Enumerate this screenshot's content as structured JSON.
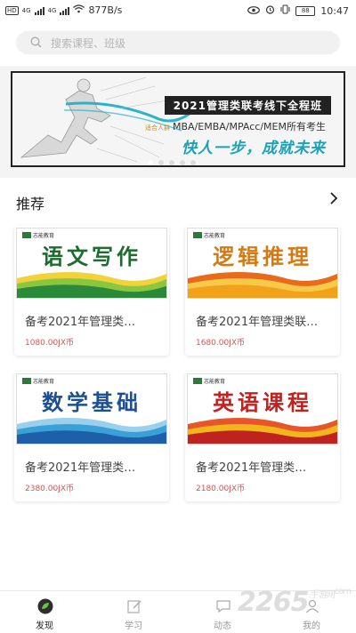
{
  "status_bar": {
    "speed": "877B/s",
    "battery": "88",
    "time": "10:47",
    "hd1": "HD",
    "hd2": "HD",
    "net1": "4G",
    "net2": "4G"
  },
  "search": {
    "placeholder": "搜索课程、班级"
  },
  "banner": {
    "title": "2021管理类联考线下全程班",
    "sub_small": "适合人群",
    "subtitle": "MBA/EMBA/MPAcc/MEM所有考生",
    "slogan": "快人一步，成就未来",
    "dots": 5,
    "active_dot": 0
  },
  "recommend": {
    "heading": "推荐",
    "more_icon": "chevron-right-icon",
    "courses": [
      {
        "cover_title": "语文写作",
        "logo": "志能教育",
        "name": "备考2021年管理类…",
        "price": "1080.00JX币",
        "title_color": "#1e6b2e",
        "wave": "green"
      },
      {
        "cover_title": "逻辑推理",
        "logo": "志能教育",
        "name": "备考2021年管理类联…",
        "price": "1680.00JX币",
        "title_color": "#d37a12",
        "wave": "orange"
      },
      {
        "cover_title": "数学基础",
        "logo": "志能教育",
        "name": "备考2021年管理类…",
        "price": "2380.00JX币",
        "title_color": "#1d4f91",
        "wave": "blue"
      },
      {
        "cover_title": "英语课程",
        "logo": "志能教育",
        "name": "备考2021年管理类…",
        "price": "2180.00JX币",
        "title_color": "#c0221f",
        "wave": "red"
      }
    ]
  },
  "tabbar": {
    "tabs": [
      {
        "label": "发现",
        "icon": "compass-leaf-icon",
        "active": true
      },
      {
        "label": "学习",
        "icon": "notebook-pencil-icon",
        "active": false
      },
      {
        "label": "动态",
        "icon": "chat-icon",
        "active": false
      },
      {
        "label": "我的",
        "icon": "person-icon",
        "active": false
      }
    ]
  },
  "watermark": {
    "text": "2265",
    "sub": ".手游网",
    "site": "com"
  },
  "colors": {
    "accent_green": "#3a9a3e",
    "price_red": "#d9534f",
    "slogan_teal": "#1aa3b8"
  }
}
